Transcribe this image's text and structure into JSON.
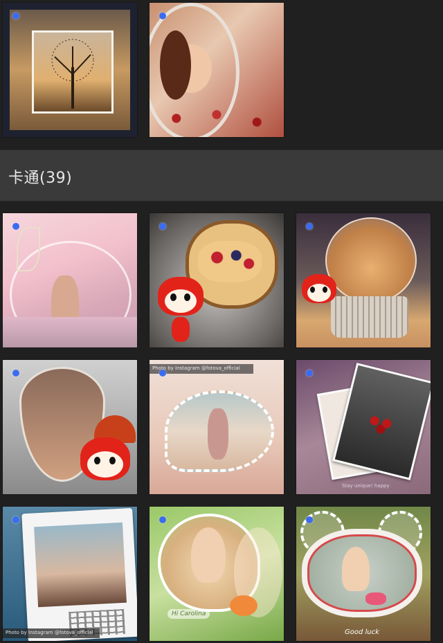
{
  "section": {
    "title": "卡通(39)"
  },
  "row0": [
    {
      "name": "frame-tree-sunset"
    },
    {
      "name": "frame-oval-roses"
    }
  ],
  "row1": [
    {
      "name": "frame-bubble-girl-meadow"
    },
    {
      "name": "frame-cloud-dessert-fox"
    },
    {
      "name": "frame-snowglobe-kitten"
    }
  ],
  "row2": [
    {
      "name": "frame-drop-fox"
    },
    {
      "name": "frame-bubble-beach",
      "caption": "Photo by Instagram @fotova_official"
    },
    {
      "name": "frame-cards-rose",
      "caption": "Stay unique! happy"
    }
  ],
  "row3": [
    {
      "name": "frame-calendar",
      "caption": "Photo by Instagram @fotova_official"
    },
    {
      "name": "frame-bubble-doll",
      "label": "Hi Carolina"
    },
    {
      "name": "frame-bear-ears",
      "label": "Good luck"
    }
  ],
  "colors": {
    "dot": "#3b6cf0",
    "background": "#202020",
    "header": "#3a3a3a"
  }
}
